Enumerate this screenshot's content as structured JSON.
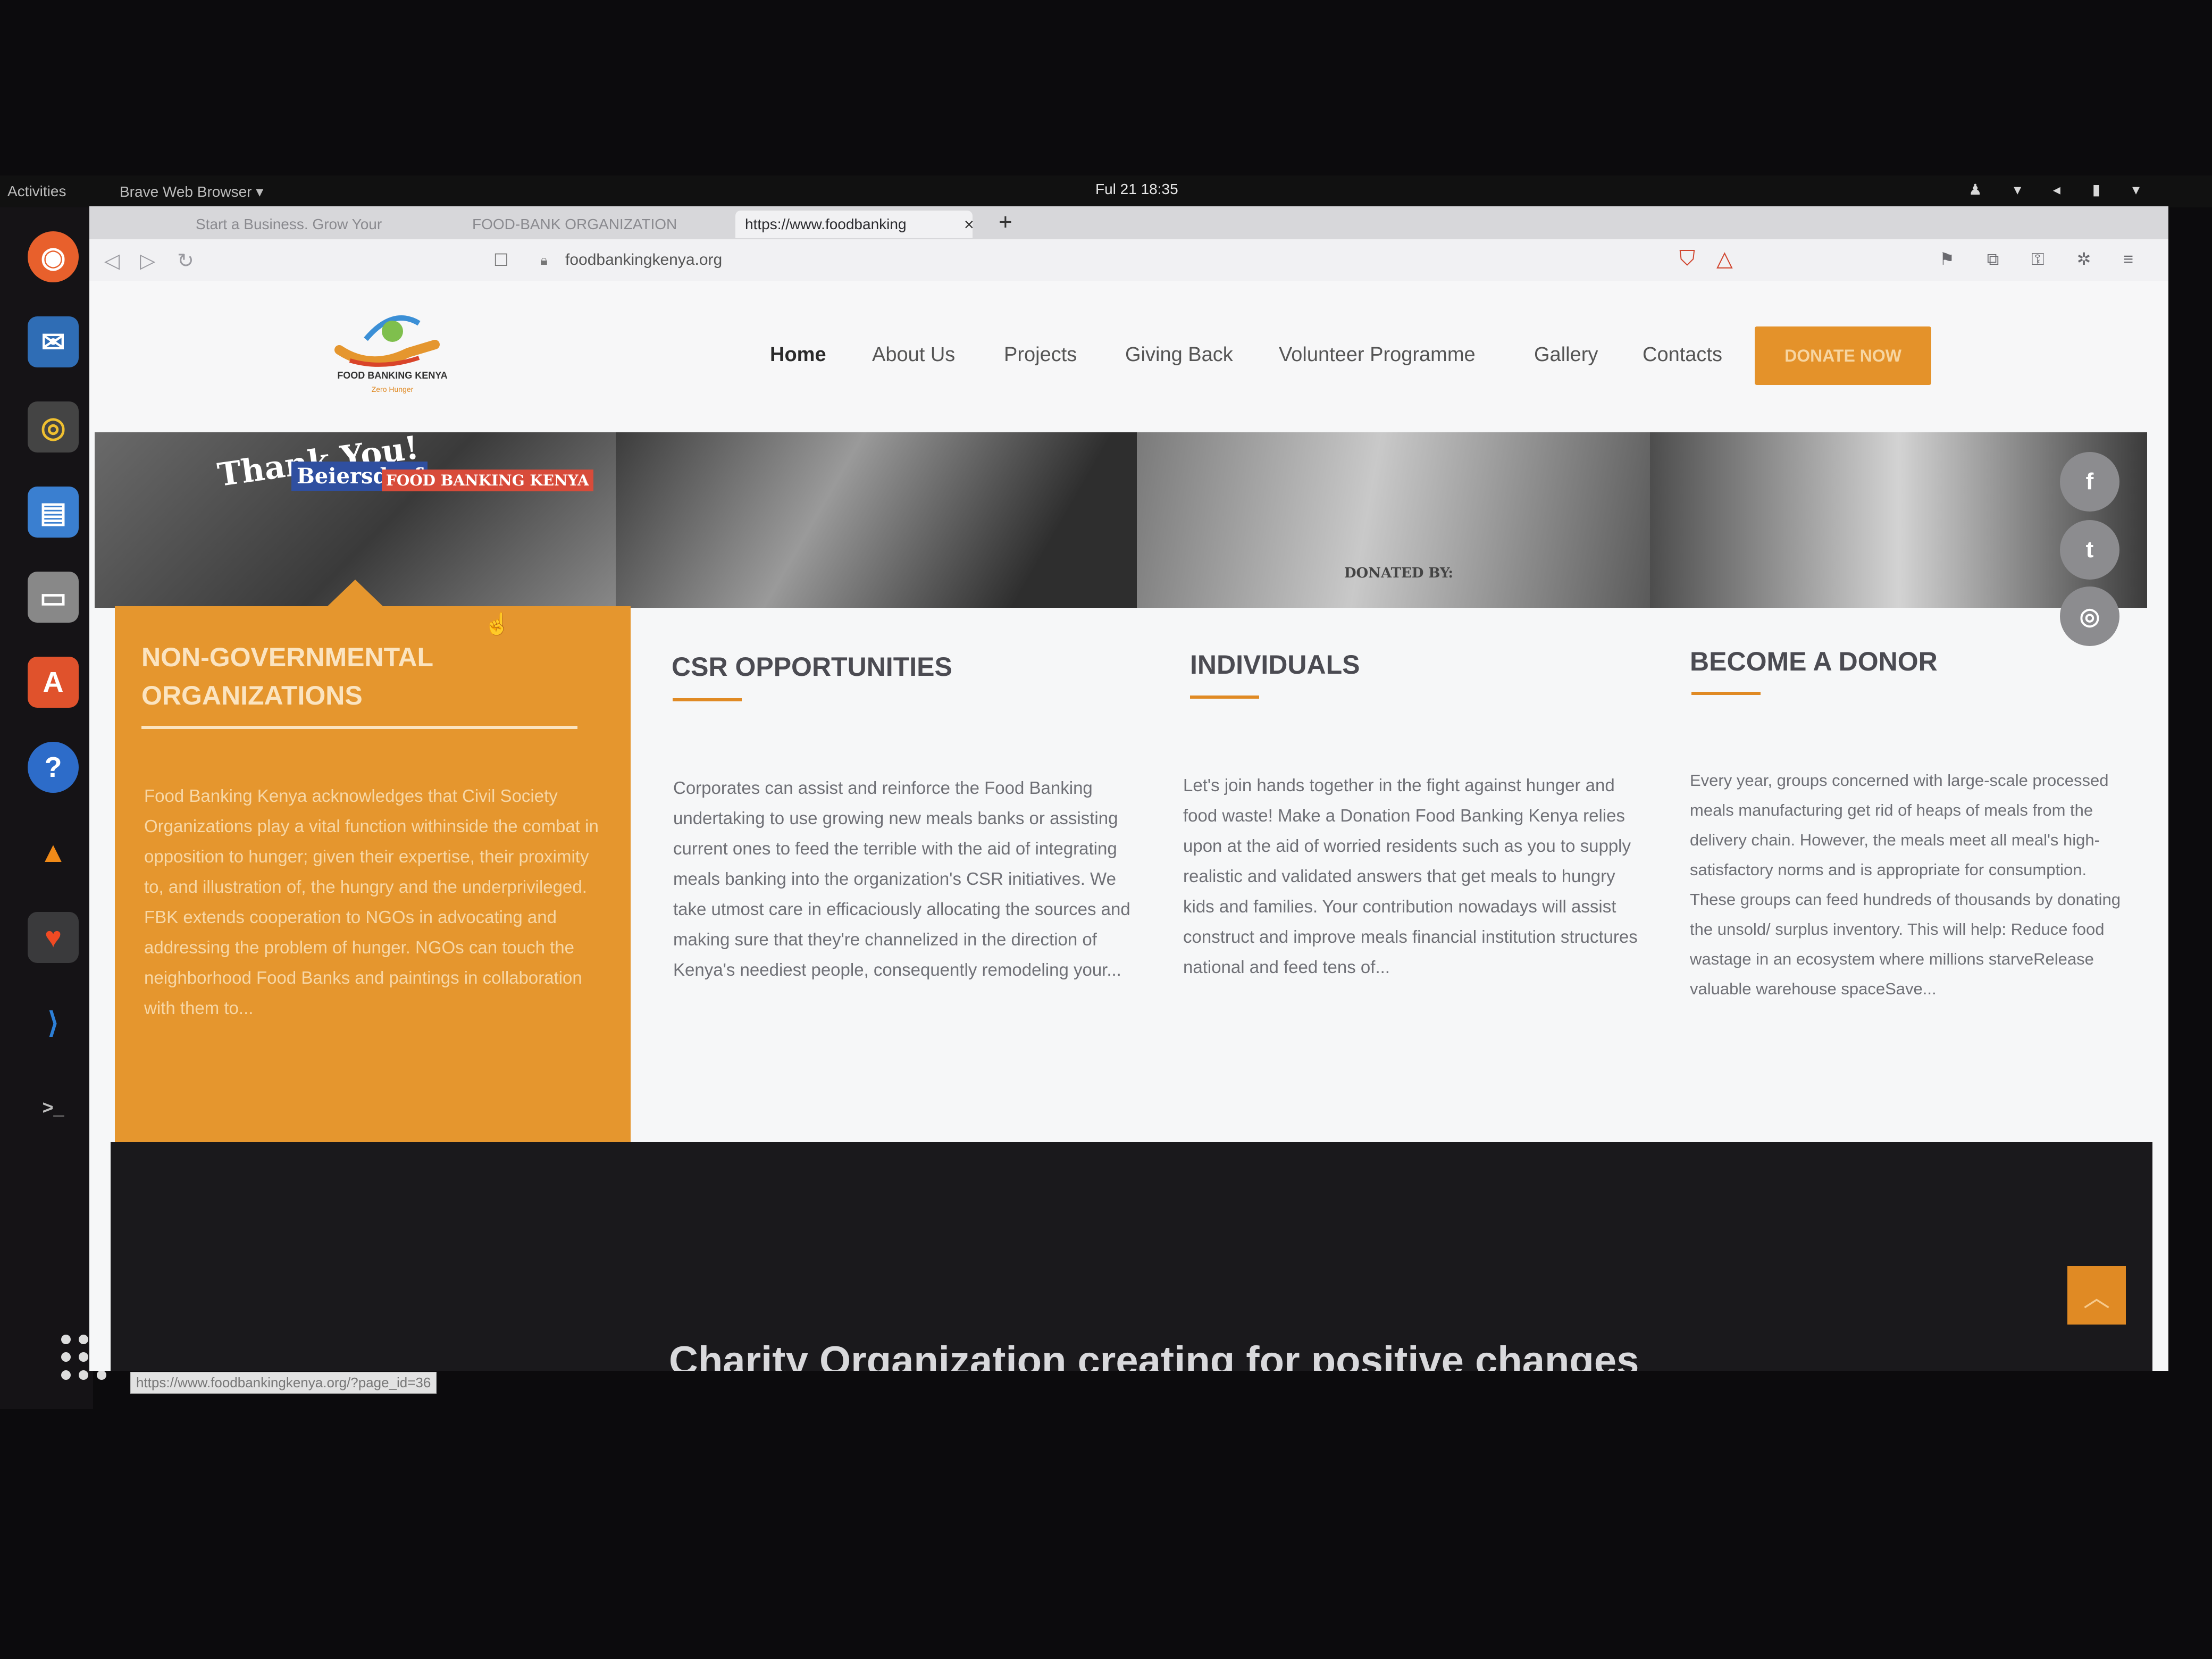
{
  "os": {
    "activities": "Activities",
    "app_menu": "Brave Web Browser ▾",
    "clock": "Ful 21  18:35",
    "tray": "♟ ▾ ◂ ▮ ▾"
  },
  "browser": {
    "tabs": [
      {
        "label": "Start a Business. Grow Your"
      },
      {
        "label": "FOOD-BANK ORGANIZATION"
      },
      {
        "label": "https://www.foodbanking"
      }
    ],
    "close_glyph": "×",
    "new_tab_glyph": "+",
    "back": "◁",
    "forward": "▷",
    "reload": "↻",
    "url": "foodbankingkenya.org",
    "status_url": "https://www.foodbankingkenya.org/?page_id=36"
  },
  "site": {
    "logo_text": "FOOD BANKING KENYA",
    "logo_tagline": "Zero Hunger",
    "nav": [
      "Home",
      "About Us",
      "Projects",
      "Giving Back",
      "Volunteer Programme",
      "Gallery",
      "Contacts"
    ],
    "donate_label": "DONATE NOW",
    "photo_signs": [
      "Thank You!",
      "Beiersdorf",
      "FOOD BANKING KENYA",
      "DONATED BY:"
    ],
    "social": [
      {
        "label": "f",
        "icon": "facebook-icon"
      },
      {
        "label": "t",
        "icon": "twitter-icon"
      },
      {
        "label": "◎",
        "icon": "instagram-icon"
      }
    ],
    "cards": [
      {
        "title": "NON-GOVERNMENTAL ORGANIZATIONS",
        "body": "Food Banking Kenya acknowledges that Civil Society Organizations play a vital function withinside the combat in opposition to hunger; given their expertise, their proximity to, and illustration of, the hungry and the underprivileged. FBK extends cooperation to NGOs in advocating and addressing the problem of hunger. NGOs can touch the neighborhood Food Banks and paintings in collaboration with them to..."
      },
      {
        "title": "CSR OPPORTUNITIES",
        "body": "Corporates can assist and reinforce the Food Banking undertaking to use growing new meals banks or assisting current ones to feed the terrible with the aid of integrating meals banking into the organization's CSR initiatives. We take utmost care in efficaciously allocating the sources and making sure that they're channelized in the direction of Kenya's neediest people, consequently remodeling your..."
      },
      {
        "title": "INDIVIDUALS",
        "body": "Let's join hands together in the fight against hunger and food waste! Make a Donation Food Banking Kenya relies upon at the aid of worried residents such as you to supply realistic and validated answers that get meals to hungry kids and families. Your contribution nowadays will assist construct and improve meals financial institution structures national and feed tens of..."
      },
      {
        "title": "BECOME A DONOR",
        "body": "Every year, groups concerned with large-scale processed meals manufacturing get rid of heaps of meals from the delivery chain. However, the meals meet all meal's high-satisfactory norms and is appropriate for consumption. These groups can feed hundreds of thousands by donating the unsold/ surplus inventory. This will help: Reduce food wastage in an ecosystem where millions starveRelease valuable warehouse spaceSave..."
      }
    ],
    "footer_heading": "Charity Organization creating for positive changes",
    "back_to_top": "︿"
  },
  "colors": {
    "accent": "#e5962e",
    "page_bg": "#f6f7f8",
    "footer_bg": "#1a191c"
  }
}
